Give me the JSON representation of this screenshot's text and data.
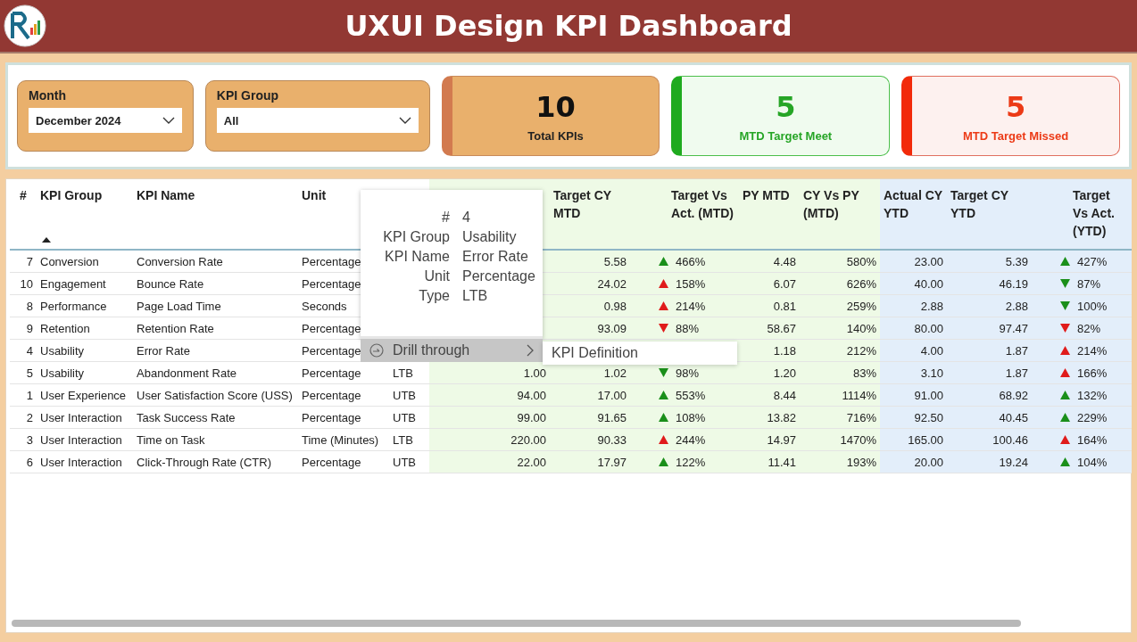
{
  "header": {
    "title": "UXUI Design KPI Dashboard"
  },
  "slicers": [
    {
      "label": "Month",
      "value": "December 2024"
    },
    {
      "label": "KPI Group",
      "value": "All"
    }
  ],
  "cards": [
    {
      "kind": "neutral",
      "value": "10",
      "label": "Total KPIs"
    },
    {
      "kind": "good",
      "value": "5",
      "label": "MTD Target Meet"
    },
    {
      "kind": "bad",
      "value": "5",
      "label": "MTD Target Missed"
    }
  ],
  "table": {
    "columns": [
      {
        "label": "#"
      },
      {
        "label": "KPI Group",
        "sorted": true
      },
      {
        "label": "KPI Name"
      },
      {
        "label": "Unit"
      },
      {},
      {},
      {
        "label": "Target CY MTD"
      },
      {
        "label": "Target Vs Act. (MTD)"
      },
      {
        "label": "PY MTD"
      },
      {
        "label": "CY Vs PY (MTD)"
      },
      {
        "label": "Actual CY YTD"
      },
      {
        "label": "Target CY YTD"
      },
      {
        "label": "Target Vs Act. (YTD)"
      }
    ],
    "rows": [
      {
        "num": "7",
        "group": "Conversion",
        "name": "Conversion Rate",
        "unit": "Percentage",
        "target_mtd": "5.58",
        "tva_mtd": {
          "value": "466%",
          "up": true,
          "color": "#1a8f1a"
        },
        "py_mtd": "4.48",
        "cy_vs_py": "580%",
        "actual_ytd": "23.00",
        "target_ytd": "5.39",
        "tva_ytd": {
          "value": "427%",
          "up": true,
          "color": "#1a8f1a"
        }
      },
      {
        "num": "10",
        "group": "Engagement",
        "name": "Bounce Rate",
        "unit": "Percentage",
        "target_mtd": "24.02",
        "tva_mtd": {
          "value": "158%",
          "up": true,
          "color": "#e01b1b"
        },
        "py_mtd": "6.07",
        "cy_vs_py": "626%",
        "actual_ytd": "40.00",
        "target_ytd": "46.19",
        "tva_ytd": {
          "value": "87%",
          "up": false,
          "color": "#1a8f1a"
        }
      },
      {
        "num": "8",
        "group": "Performance",
        "name": "Page Load Time",
        "unit": "Seconds",
        "target_mtd": "0.98",
        "tva_mtd": {
          "value": "214%",
          "up": true,
          "color": "#e01b1b"
        },
        "py_mtd": "0.81",
        "cy_vs_py": "259%",
        "actual_ytd": "2.88",
        "target_ytd": "2.88",
        "tva_ytd": {
          "value": "100%",
          "up": false,
          "color": "#1a8f1a"
        }
      },
      {
        "num": "9",
        "group": "Retention",
        "name": "Retention Rate",
        "unit": "Percentage",
        "target_mtd": "93.09",
        "tva_mtd": {
          "value": "88%",
          "up": false,
          "color": "#e01b1b"
        },
        "py_mtd": "58.67",
        "cy_vs_py": "140%",
        "actual_ytd": "80.00",
        "target_ytd": "97.47",
        "tva_ytd": {
          "value": "82%",
          "up": false,
          "color": "#e01b1b"
        }
      },
      {
        "num": "4",
        "group": "Usability",
        "name": "Error Rate",
        "unit": "Percentage",
        "py_mtd": "1.18",
        "cy_vs_py": "212%",
        "actual_ytd": "4.00",
        "target_ytd": "1.87",
        "tva_ytd": {
          "value": "214%",
          "up": true,
          "color": "#e01b1b"
        }
      },
      {
        "num": "5",
        "group": "Usability",
        "name": "Abandonment Rate",
        "unit": "Percentage",
        "type": "LTB",
        "actual_mtd": "1.00",
        "target_mtd": "1.02",
        "tva_mtd": {
          "value": "98%",
          "up": false,
          "color": "#1a8f1a"
        },
        "py_mtd": "1.20",
        "cy_vs_py": "83%",
        "actual_ytd": "3.10",
        "target_ytd": "1.87",
        "tva_ytd": {
          "value": "166%",
          "up": true,
          "color": "#e01b1b"
        }
      },
      {
        "num": "1",
        "group": "User Experience",
        "name": "User Satisfaction Score (USS)",
        "unit": "Percentage",
        "type": "UTB",
        "actual_mtd": "94.00",
        "target_mtd": "17.00",
        "tva_mtd": {
          "value": "553%",
          "up": true,
          "color": "#1a8f1a"
        },
        "py_mtd": "8.44",
        "cy_vs_py": "1114%",
        "actual_ytd": "91.00",
        "target_ytd": "68.92",
        "tva_ytd": {
          "value": "132%",
          "up": true,
          "color": "#1a8f1a"
        }
      },
      {
        "num": "2",
        "group": "User Interaction",
        "name": "Task Success Rate",
        "unit": "Percentage",
        "type": "UTB",
        "actual_mtd": "99.00",
        "target_mtd": "91.65",
        "tva_mtd": {
          "value": "108%",
          "up": true,
          "color": "#1a8f1a"
        },
        "py_mtd": "13.82",
        "cy_vs_py": "716%",
        "actual_ytd": "92.50",
        "target_ytd": "40.45",
        "tva_ytd": {
          "value": "229%",
          "up": true,
          "color": "#1a8f1a"
        }
      },
      {
        "num": "3",
        "group": "User Interaction",
        "name": "Time on Task",
        "unit": "Time (Minutes)",
        "type": "LTB",
        "actual_mtd": "220.00",
        "target_mtd": "90.33",
        "tva_mtd": {
          "value": "244%",
          "up": true,
          "color": "#e01b1b"
        },
        "py_mtd": "14.97",
        "cy_vs_py": "1470%",
        "actual_ytd": "165.00",
        "target_ytd": "100.46",
        "tva_ytd": {
          "value": "164%",
          "up": true,
          "color": "#e01b1b"
        }
      },
      {
        "num": "6",
        "group": "User Interaction",
        "name": "Click-Through Rate (CTR)",
        "unit": "Percentage",
        "type": "UTB",
        "actual_mtd": "22.00",
        "target_mtd": "17.97",
        "tva_mtd": {
          "value": "122%",
          "up": true,
          "color": "#1a8f1a"
        },
        "py_mtd": "11.41",
        "cy_vs_py": "193%",
        "actual_ytd": "20.00",
        "target_ytd": "19.24",
        "tva_ytd": {
          "value": "104%",
          "up": true,
          "color": "#1a8f1a"
        }
      }
    ]
  },
  "context_menu": {
    "fields": [
      {
        "label": "#",
        "value": "4"
      },
      {
        "label": "KPI Group",
        "value": "Usability"
      },
      {
        "label": "KPI Name",
        "value": "Error Rate"
      },
      {
        "label": "Unit",
        "value": "Percentage"
      },
      {
        "label": "Type",
        "value": "LTB"
      }
    ],
    "item": "Drill through",
    "submenu": [
      "KPI Definition"
    ]
  }
}
